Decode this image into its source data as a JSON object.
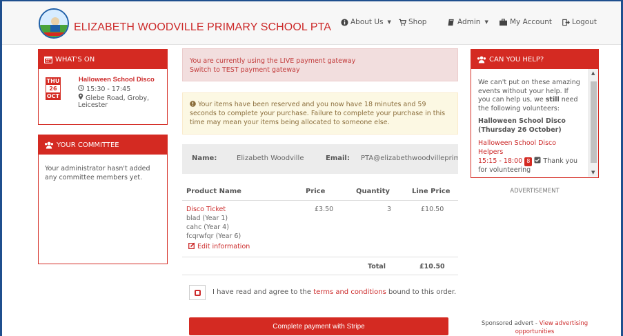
{
  "header": {
    "brand": "ELIZABETH WOODVILLE PRIMARY SCHOOL PTA",
    "nav": {
      "about": "About Us",
      "shop": "Shop",
      "admin": "Admin",
      "account": "My Account",
      "logout": "Logout"
    }
  },
  "whats_on": {
    "title": "WHAT'S ON",
    "event": {
      "day": "THU",
      "date": "26",
      "month": "OCT",
      "name": "Halloween School Disco",
      "time": "15:30 - 17:45",
      "location_line1": "Glebe Road, Groby,",
      "location_line2": "Leicester"
    }
  },
  "committee": {
    "title": "YOUR COMMITTEE",
    "text": "Your administrator hasn't added any committee members yet."
  },
  "alerts": {
    "live_line1": "You are currently using the LIVE payment gateway",
    "live_line2": "Switch to TEST payment gateway",
    "reserved": "Your items have been reserved and you now have 18 minutes and 59 seconds to complete your purchase. Failure to complete your purchase in this time may mean your items being allocated to someone else."
  },
  "customer": {
    "name_label": "Name:",
    "name_value": "Elizabeth Woodville",
    "email_label": "Email:",
    "email_value": "PTA@elizabethwoodvilleprimary"
  },
  "order_table": {
    "headers": [
      "Product Name",
      "Price",
      "Quantity",
      "Line Price"
    ],
    "item": {
      "name": "Disco Ticket",
      "attendees": [
        "blad (Year 1)",
        "cahc (Year 4)",
        "fcqrwfqr (Year 6)"
      ],
      "edit_label": "Edit information",
      "price": "£3.50",
      "quantity": "3",
      "line_price": "£10.50"
    },
    "total_label": "Total",
    "total_value": "£10.50"
  },
  "agreement": {
    "prefix": "I have read and agree to the ",
    "link": "terms and conditions",
    "suffix": " bound to this order."
  },
  "pay_button": "Complete payment with Stripe",
  "help": {
    "title": "CAN YOU HELP?",
    "intro_1": "We can't put on these amazing events without your help. If you can help us, we ",
    "intro_bold": "still",
    "intro_2": " need the following volunteers:",
    "event_heading": "Halloween School Disco (Thursday 26 October)",
    "role": "Halloween School Disco Helpers",
    "role_time": "15:15 - 18:00",
    "badge": "8",
    "thanks": "Thank you for volunteering"
  },
  "advert_label": "ADVERTISEMENT",
  "sponsor": {
    "prefix": "Sponsored advert - ",
    "link": "View advertising opportunities"
  },
  "colors": {
    "brand_red": "#d42a22",
    "nav_bg": "#f7f7f7",
    "alert_red_bg": "#f2dede",
    "alert_yellow_bg": "#fcf8e3"
  }
}
